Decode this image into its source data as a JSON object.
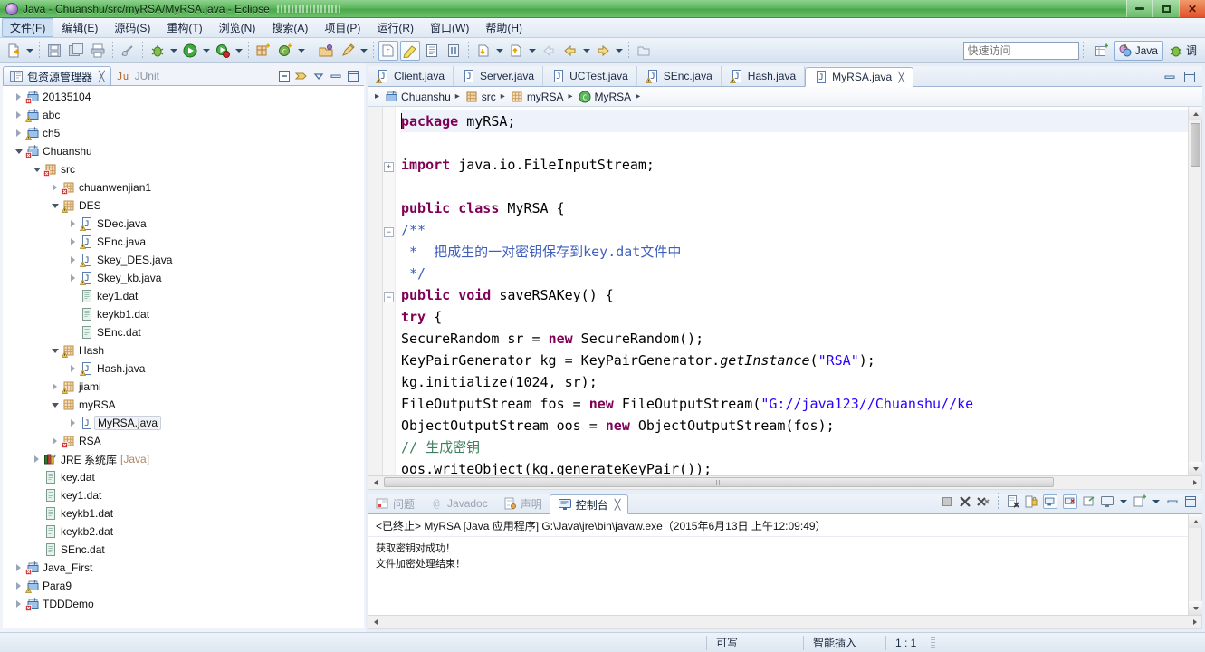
{
  "window": {
    "title": "Java - Chuanshu/src/myRSA/MyRSA.java - Eclipse",
    "minimize": "–",
    "maximize": "□",
    "close": "✕"
  },
  "menubar": {
    "items": [
      {
        "label": "文件(F)",
        "name": "menu-file",
        "active": true
      },
      {
        "label": "编辑(E)",
        "name": "menu-edit",
        "active": false
      },
      {
        "label": "源码(S)",
        "name": "menu-source",
        "active": false
      },
      {
        "label": "重构(T)",
        "name": "menu-refactor",
        "active": false
      },
      {
        "label": "浏览(N)",
        "name": "menu-navigate",
        "active": false
      },
      {
        "label": "搜索(A)",
        "name": "menu-search",
        "active": false
      },
      {
        "label": "项目(P)",
        "name": "menu-project",
        "active": false
      },
      {
        "label": "运行(R)",
        "name": "menu-run",
        "active": false
      },
      {
        "label": "窗口(W)",
        "name": "menu-window",
        "active": false
      },
      {
        "label": "帮助(H)",
        "name": "menu-help",
        "active": false
      }
    ]
  },
  "toolbar": {
    "quick_access_placeholder": "快速访问",
    "quick_access_value": "",
    "perspective_java": "Java",
    "perspective_debug": "调"
  },
  "explorer": {
    "tab_label": "包资源管理器",
    "tab_close": "╳",
    "junit_tab_label": "JUnit",
    "tree": [
      {
        "label": "20135104",
        "depth": 0,
        "twist": "collapsed",
        "icon": "java-project-error-icon",
        "selected": false
      },
      {
        "label": "abc",
        "depth": 0,
        "twist": "collapsed",
        "icon": "java-project-warning-icon",
        "selected": false
      },
      {
        "label": "ch5",
        "depth": 0,
        "twist": "collapsed",
        "icon": "java-project-warning-icon",
        "selected": false
      },
      {
        "label": "Chuanshu",
        "depth": 0,
        "twist": "expanded",
        "icon": "java-project-error-icon",
        "selected": false
      },
      {
        "label": "src",
        "depth": 1,
        "twist": "expanded",
        "icon": "source-folder-error-icon",
        "selected": false
      },
      {
        "label": "chuanwenjian1",
        "depth": 2,
        "twist": "collapsed",
        "icon": "package-error-icon",
        "selected": false
      },
      {
        "label": "DES",
        "depth": 2,
        "twist": "expanded",
        "icon": "package-warning-icon",
        "selected": false
      },
      {
        "label": "SDec.java",
        "depth": 3,
        "twist": "collapsed",
        "icon": "java-file-warning-icon",
        "selected": false
      },
      {
        "label": "SEnc.java",
        "depth": 3,
        "twist": "collapsed",
        "icon": "java-file-warning-icon",
        "selected": false
      },
      {
        "label": "Skey_DES.java",
        "depth": 3,
        "twist": "collapsed",
        "icon": "java-file-warning-icon",
        "selected": false
      },
      {
        "label": "Skey_kb.java",
        "depth": 3,
        "twist": "collapsed",
        "icon": "java-file-warning-icon",
        "selected": false
      },
      {
        "label": "key1.dat",
        "depth": 3,
        "twist": "none",
        "icon": "data-file-icon",
        "selected": false
      },
      {
        "label": "keykb1.dat",
        "depth": 3,
        "twist": "none",
        "icon": "data-file-icon",
        "selected": false
      },
      {
        "label": "SEnc.dat",
        "depth": 3,
        "twist": "none",
        "icon": "data-file-icon",
        "selected": false
      },
      {
        "label": "Hash",
        "depth": 2,
        "twist": "expanded",
        "icon": "package-warning-icon",
        "selected": false
      },
      {
        "label": "Hash.java",
        "depth": 3,
        "twist": "collapsed",
        "icon": "java-file-warning-icon",
        "selected": false
      },
      {
        "label": "jiami",
        "depth": 2,
        "twist": "collapsed",
        "icon": "package-warning-icon",
        "selected": false
      },
      {
        "label": "myRSA",
        "depth": 2,
        "twist": "expanded",
        "icon": "package-icon",
        "selected": false
      },
      {
        "label": "MyRSA.java",
        "depth": 3,
        "twist": "collapsed",
        "icon": "java-file-icon",
        "selected": true
      },
      {
        "label": "RSA",
        "depth": 2,
        "twist": "collapsed",
        "icon": "package-error-icon",
        "selected": false
      },
      {
        "label": "JRE 系统库",
        "depth": 1,
        "twist": "collapsed",
        "icon": "jre-library-icon",
        "selected": false,
        "suffix": "[Java]"
      },
      {
        "label": "key.dat",
        "depth": 1,
        "twist": "none",
        "icon": "data-file-icon",
        "selected": false
      },
      {
        "label": "key1.dat",
        "depth": 1,
        "twist": "none",
        "icon": "data-file-icon",
        "selected": false
      },
      {
        "label": "keykb1.dat",
        "depth": 1,
        "twist": "none",
        "icon": "data-file-icon",
        "selected": false
      },
      {
        "label": "keykb2.dat",
        "depth": 1,
        "twist": "none",
        "icon": "data-file-icon",
        "selected": false
      },
      {
        "label": "SEnc.dat",
        "depth": 1,
        "twist": "none",
        "icon": "data-file-icon",
        "selected": false
      },
      {
        "label": "Java_First",
        "depth": 0,
        "twist": "collapsed",
        "icon": "java-project-error-icon",
        "selected": false
      },
      {
        "label": "Para9",
        "depth": 0,
        "twist": "collapsed",
        "icon": "java-project-warning-icon",
        "selected": false
      },
      {
        "label": "TDDDemo",
        "depth": 0,
        "twist": "collapsed",
        "icon": "java-project-error-icon",
        "selected": false
      }
    ]
  },
  "editor": {
    "tabs": [
      {
        "label": "Client.java",
        "icon": "java-file-warning-icon",
        "active": false
      },
      {
        "label": "Server.java",
        "icon": "java-file-icon",
        "active": false
      },
      {
        "label": "UCTest.java",
        "icon": "java-file-icon",
        "active": false
      },
      {
        "label": "SEnc.java",
        "icon": "java-file-warning-icon",
        "active": false
      },
      {
        "label": "Hash.java",
        "icon": "java-file-warning-icon",
        "active": false
      },
      {
        "label": "MyRSA.java",
        "icon": "java-file-icon",
        "active": true
      }
    ],
    "active_tab_close": "╳",
    "breadcrumb": [
      {
        "label": "Chuanshu",
        "icon": "java-project-icon"
      },
      {
        "label": "src",
        "icon": "source-folder-icon"
      },
      {
        "label": "myRSA",
        "icon": "package-icon"
      },
      {
        "label": "MyRSA",
        "icon": "class-icon"
      }
    ],
    "breadcrumb_sep": "▸",
    "code_lines": [
      {
        "segments": [
          {
            "t": "package",
            "c": "kw"
          },
          {
            "t": " myRSA;",
            "c": ""
          }
        ],
        "cursor": true,
        "fold": "none"
      },
      {
        "segments": [],
        "fold": "none"
      },
      {
        "segments": [
          {
            "t": "import",
            "c": "kw"
          },
          {
            "t": " java.io.FileInputStream;",
            "c": ""
          }
        ],
        "fold": "plus"
      },
      {
        "segments": [],
        "fold": "none"
      },
      {
        "segments": [
          {
            "t": "public class",
            "c": "kw"
          },
          {
            "t": " MyRSA {",
            "c": ""
          }
        ],
        "fold": "none"
      },
      {
        "segments": [
          {
            "t": "/**",
            "c": "jdoc"
          }
        ],
        "fold": "minus"
      },
      {
        "segments": [
          {
            "t": " *  把成生的一对密钥保存到key.dat文件中",
            "c": "jdoc"
          }
        ],
        "fold": "none"
      },
      {
        "segments": [
          {
            "t": " */",
            "c": "jdoc"
          }
        ],
        "fold": "none"
      },
      {
        "segments": [
          {
            "t": "public void",
            "c": "kw"
          },
          {
            "t": " saveRSAKey() {",
            "c": ""
          }
        ],
        "fold": "minus"
      },
      {
        "segments": [
          {
            "t": "try",
            "c": "kw"
          },
          {
            "t": " {",
            "c": ""
          }
        ],
        "fold": "none"
      },
      {
        "segments": [
          {
            "t": "SecureRandom sr = ",
            "c": ""
          },
          {
            "t": "new",
            "c": "kw"
          },
          {
            "t": " SecureRandom();",
            "c": ""
          }
        ],
        "fold": "none"
      },
      {
        "segments": [
          {
            "t": "KeyPairGenerator kg = KeyPairGenerator.",
            "c": ""
          },
          {
            "t": "getInstance",
            "c": "ital"
          },
          {
            "t": "(",
            "c": ""
          },
          {
            "t": "\"RSA\"",
            "c": "str"
          },
          {
            "t": ");",
            "c": ""
          }
        ],
        "fold": "none"
      },
      {
        "segments": [
          {
            "t": "kg.initialize(1024, sr);",
            "c": ""
          }
        ],
        "fold": "none"
      },
      {
        "segments": [
          {
            "t": "FileOutputStream fos = ",
            "c": ""
          },
          {
            "t": "new",
            "c": "kw"
          },
          {
            "t": " FileOutputStream(",
            "c": ""
          },
          {
            "t": "\"G://java123//Chuanshu//ke",
            "c": "str"
          }
        ],
        "fold": "none"
      },
      {
        "segments": [
          {
            "t": "ObjectOutputStream oos = ",
            "c": ""
          },
          {
            "t": "new",
            "c": "kw"
          },
          {
            "t": " ObjectOutputStream(fos);",
            "c": ""
          }
        ],
        "fold": "none"
      },
      {
        "segments": [
          {
            "t": "// 生成密钥",
            "c": "cmt"
          }
        ],
        "fold": "none"
      },
      {
        "segments": [
          {
            "t": "oos.writeObject(kg.generateKeyPair());",
            "c": ""
          }
        ],
        "fold": "none"
      }
    ]
  },
  "console": {
    "tabs": [
      {
        "label": "问题",
        "icon": "problems-icon",
        "active": false
      },
      {
        "label": "Javadoc",
        "icon": "javadoc-icon",
        "active": false
      },
      {
        "label": "声明",
        "icon": "declaration-icon",
        "active": false
      },
      {
        "label": "控制台",
        "icon": "console-icon",
        "active": true
      }
    ],
    "active_tab_close": "╳",
    "header": "<已终止> MyRSA [Java 应用程序] G:\\Java\\jre\\bin\\javaw.exe（2015年6月13日 上午12:09:49）",
    "output": [
      "获取密钥对成功！",
      "文件加密处理结束！"
    ]
  },
  "statusbar": {
    "writable": "可写",
    "insert_mode": "智能插入",
    "position": "1 : 1"
  },
  "colors": {
    "titlebar_green": "#5fb85f",
    "keyword": "#7f0055",
    "string": "#2a00ff",
    "comment": "#3f7f5f",
    "javadoc": "#3f5fbf",
    "accent_blue": "#9db5d2"
  }
}
